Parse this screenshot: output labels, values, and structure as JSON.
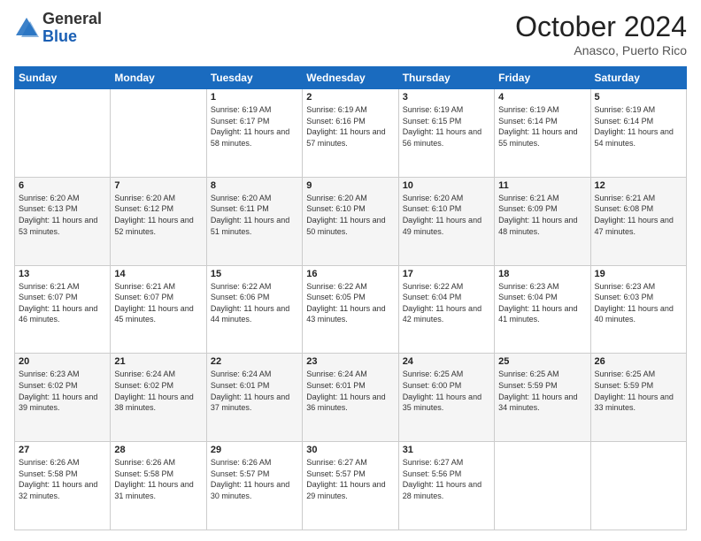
{
  "header": {
    "logo_general": "General",
    "logo_blue": "Blue",
    "month_title": "October 2024",
    "location": "Anasco, Puerto Rico"
  },
  "days_of_week": [
    "Sunday",
    "Monday",
    "Tuesday",
    "Wednesday",
    "Thursday",
    "Friday",
    "Saturday"
  ],
  "weeks": [
    [
      {
        "day": "",
        "sunrise": "",
        "sunset": "",
        "daylight": ""
      },
      {
        "day": "",
        "sunrise": "",
        "sunset": "",
        "daylight": ""
      },
      {
        "day": "1",
        "sunrise": "Sunrise: 6:19 AM",
        "sunset": "Sunset: 6:17 PM",
        "daylight": "Daylight: 11 hours and 58 minutes."
      },
      {
        "day": "2",
        "sunrise": "Sunrise: 6:19 AM",
        "sunset": "Sunset: 6:16 PM",
        "daylight": "Daylight: 11 hours and 57 minutes."
      },
      {
        "day": "3",
        "sunrise": "Sunrise: 6:19 AM",
        "sunset": "Sunset: 6:15 PM",
        "daylight": "Daylight: 11 hours and 56 minutes."
      },
      {
        "day": "4",
        "sunrise": "Sunrise: 6:19 AM",
        "sunset": "Sunset: 6:14 PM",
        "daylight": "Daylight: 11 hours and 55 minutes."
      },
      {
        "day": "5",
        "sunrise": "Sunrise: 6:19 AM",
        "sunset": "Sunset: 6:14 PM",
        "daylight": "Daylight: 11 hours and 54 minutes."
      }
    ],
    [
      {
        "day": "6",
        "sunrise": "Sunrise: 6:20 AM",
        "sunset": "Sunset: 6:13 PM",
        "daylight": "Daylight: 11 hours and 53 minutes."
      },
      {
        "day": "7",
        "sunrise": "Sunrise: 6:20 AM",
        "sunset": "Sunset: 6:12 PM",
        "daylight": "Daylight: 11 hours and 52 minutes."
      },
      {
        "day": "8",
        "sunrise": "Sunrise: 6:20 AM",
        "sunset": "Sunset: 6:11 PM",
        "daylight": "Daylight: 11 hours and 51 minutes."
      },
      {
        "day": "9",
        "sunrise": "Sunrise: 6:20 AM",
        "sunset": "Sunset: 6:10 PM",
        "daylight": "Daylight: 11 hours and 50 minutes."
      },
      {
        "day": "10",
        "sunrise": "Sunrise: 6:20 AM",
        "sunset": "Sunset: 6:10 PM",
        "daylight": "Daylight: 11 hours and 49 minutes."
      },
      {
        "day": "11",
        "sunrise": "Sunrise: 6:21 AM",
        "sunset": "Sunset: 6:09 PM",
        "daylight": "Daylight: 11 hours and 48 minutes."
      },
      {
        "day": "12",
        "sunrise": "Sunrise: 6:21 AM",
        "sunset": "Sunset: 6:08 PM",
        "daylight": "Daylight: 11 hours and 47 minutes."
      }
    ],
    [
      {
        "day": "13",
        "sunrise": "Sunrise: 6:21 AM",
        "sunset": "Sunset: 6:07 PM",
        "daylight": "Daylight: 11 hours and 46 minutes."
      },
      {
        "day": "14",
        "sunrise": "Sunrise: 6:21 AM",
        "sunset": "Sunset: 6:07 PM",
        "daylight": "Daylight: 11 hours and 45 minutes."
      },
      {
        "day": "15",
        "sunrise": "Sunrise: 6:22 AM",
        "sunset": "Sunset: 6:06 PM",
        "daylight": "Daylight: 11 hours and 44 minutes."
      },
      {
        "day": "16",
        "sunrise": "Sunrise: 6:22 AM",
        "sunset": "Sunset: 6:05 PM",
        "daylight": "Daylight: 11 hours and 43 minutes."
      },
      {
        "day": "17",
        "sunrise": "Sunrise: 6:22 AM",
        "sunset": "Sunset: 6:04 PM",
        "daylight": "Daylight: 11 hours and 42 minutes."
      },
      {
        "day": "18",
        "sunrise": "Sunrise: 6:23 AM",
        "sunset": "Sunset: 6:04 PM",
        "daylight": "Daylight: 11 hours and 41 minutes."
      },
      {
        "day": "19",
        "sunrise": "Sunrise: 6:23 AM",
        "sunset": "Sunset: 6:03 PM",
        "daylight": "Daylight: 11 hours and 40 minutes."
      }
    ],
    [
      {
        "day": "20",
        "sunrise": "Sunrise: 6:23 AM",
        "sunset": "Sunset: 6:02 PM",
        "daylight": "Daylight: 11 hours and 39 minutes."
      },
      {
        "day": "21",
        "sunrise": "Sunrise: 6:24 AM",
        "sunset": "Sunset: 6:02 PM",
        "daylight": "Daylight: 11 hours and 38 minutes."
      },
      {
        "day": "22",
        "sunrise": "Sunrise: 6:24 AM",
        "sunset": "Sunset: 6:01 PM",
        "daylight": "Daylight: 11 hours and 37 minutes."
      },
      {
        "day": "23",
        "sunrise": "Sunrise: 6:24 AM",
        "sunset": "Sunset: 6:01 PM",
        "daylight": "Daylight: 11 hours and 36 minutes."
      },
      {
        "day": "24",
        "sunrise": "Sunrise: 6:25 AM",
        "sunset": "Sunset: 6:00 PM",
        "daylight": "Daylight: 11 hours and 35 minutes."
      },
      {
        "day": "25",
        "sunrise": "Sunrise: 6:25 AM",
        "sunset": "Sunset: 5:59 PM",
        "daylight": "Daylight: 11 hours and 34 minutes."
      },
      {
        "day": "26",
        "sunrise": "Sunrise: 6:25 AM",
        "sunset": "Sunset: 5:59 PM",
        "daylight": "Daylight: 11 hours and 33 minutes."
      }
    ],
    [
      {
        "day": "27",
        "sunrise": "Sunrise: 6:26 AM",
        "sunset": "Sunset: 5:58 PM",
        "daylight": "Daylight: 11 hours and 32 minutes."
      },
      {
        "day": "28",
        "sunrise": "Sunrise: 6:26 AM",
        "sunset": "Sunset: 5:58 PM",
        "daylight": "Daylight: 11 hours and 31 minutes."
      },
      {
        "day": "29",
        "sunrise": "Sunrise: 6:26 AM",
        "sunset": "Sunset: 5:57 PM",
        "daylight": "Daylight: 11 hours and 30 minutes."
      },
      {
        "day": "30",
        "sunrise": "Sunrise: 6:27 AM",
        "sunset": "Sunset: 5:57 PM",
        "daylight": "Daylight: 11 hours and 29 minutes."
      },
      {
        "day": "31",
        "sunrise": "Sunrise: 6:27 AM",
        "sunset": "Sunset: 5:56 PM",
        "daylight": "Daylight: 11 hours and 28 minutes."
      },
      {
        "day": "",
        "sunrise": "",
        "sunset": "",
        "daylight": ""
      },
      {
        "day": "",
        "sunrise": "",
        "sunset": "",
        "daylight": ""
      }
    ]
  ]
}
